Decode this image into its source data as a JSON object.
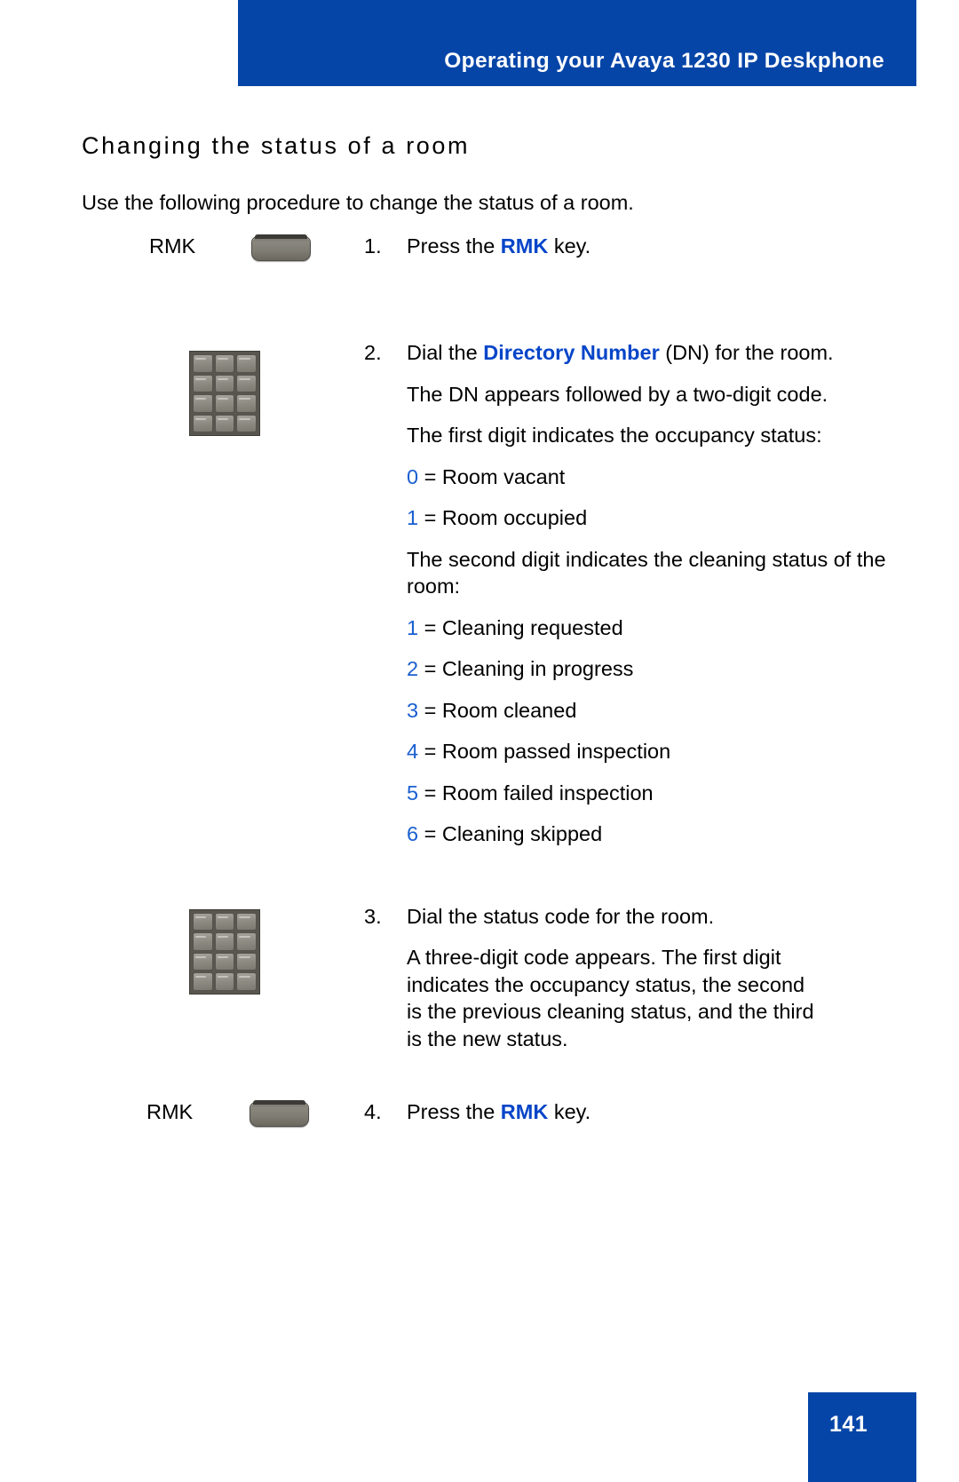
{
  "header": {
    "title": "Operating your Avaya 1230 IP Deskphone",
    "background_color": "#0545a8",
    "text_color": "#ffffff"
  },
  "page": {
    "heading": "Changing the status of a room",
    "intro": "Use the following procedure to change the status of a room.",
    "number": "141",
    "accent_color": "#0545c8"
  },
  "steps": [
    {
      "number": "1.",
      "art": "rmk-key",
      "art_label": "RMK",
      "text_before": "Press the ",
      "keyword": "RMK",
      "text_after": " key."
    },
    {
      "number": "2.",
      "art": "keypad",
      "text_before": "Dial the ",
      "keyword": "Directory Number",
      "text_after": " (DN) for the room.",
      "sub_paragraphs": [
        "The DN appears followed by a two-digit code.",
        "The first digit indicates the occupancy status:"
      ],
      "occupancy_codes": [
        {
          "digit": "0",
          "label": " = Room vacant"
        },
        {
          "digit": "1",
          "label": " = Room occupied"
        }
      ],
      "cleaning_intro": "The second digit indicates the cleaning status of the room:",
      "cleaning_codes": [
        {
          "digit": "1",
          "label": " = Cleaning requested"
        },
        {
          "digit": "2",
          "label": " = Cleaning in progress"
        },
        {
          "digit": "3",
          "label": " = Room cleaned"
        },
        {
          "digit": "4",
          "label": " = Room passed inspection"
        },
        {
          "digit": "5",
          "label": " = Room failed inspection"
        },
        {
          "digit": "6",
          "label": " = Cleaning skipped"
        }
      ]
    },
    {
      "number": "3.",
      "art": "keypad",
      "text": "Dial the status code for the room.",
      "sub_paragraphs": [
        "A three-digit code appears. The first digit indicates the occupancy status, the second is the previous cleaning status, and the third is the new status."
      ]
    },
    {
      "number": "4.",
      "art": "rmk-key",
      "art_label": "RMK",
      "text_before": "Press the ",
      "keyword": "RMK",
      "text_after": " key."
    }
  ]
}
